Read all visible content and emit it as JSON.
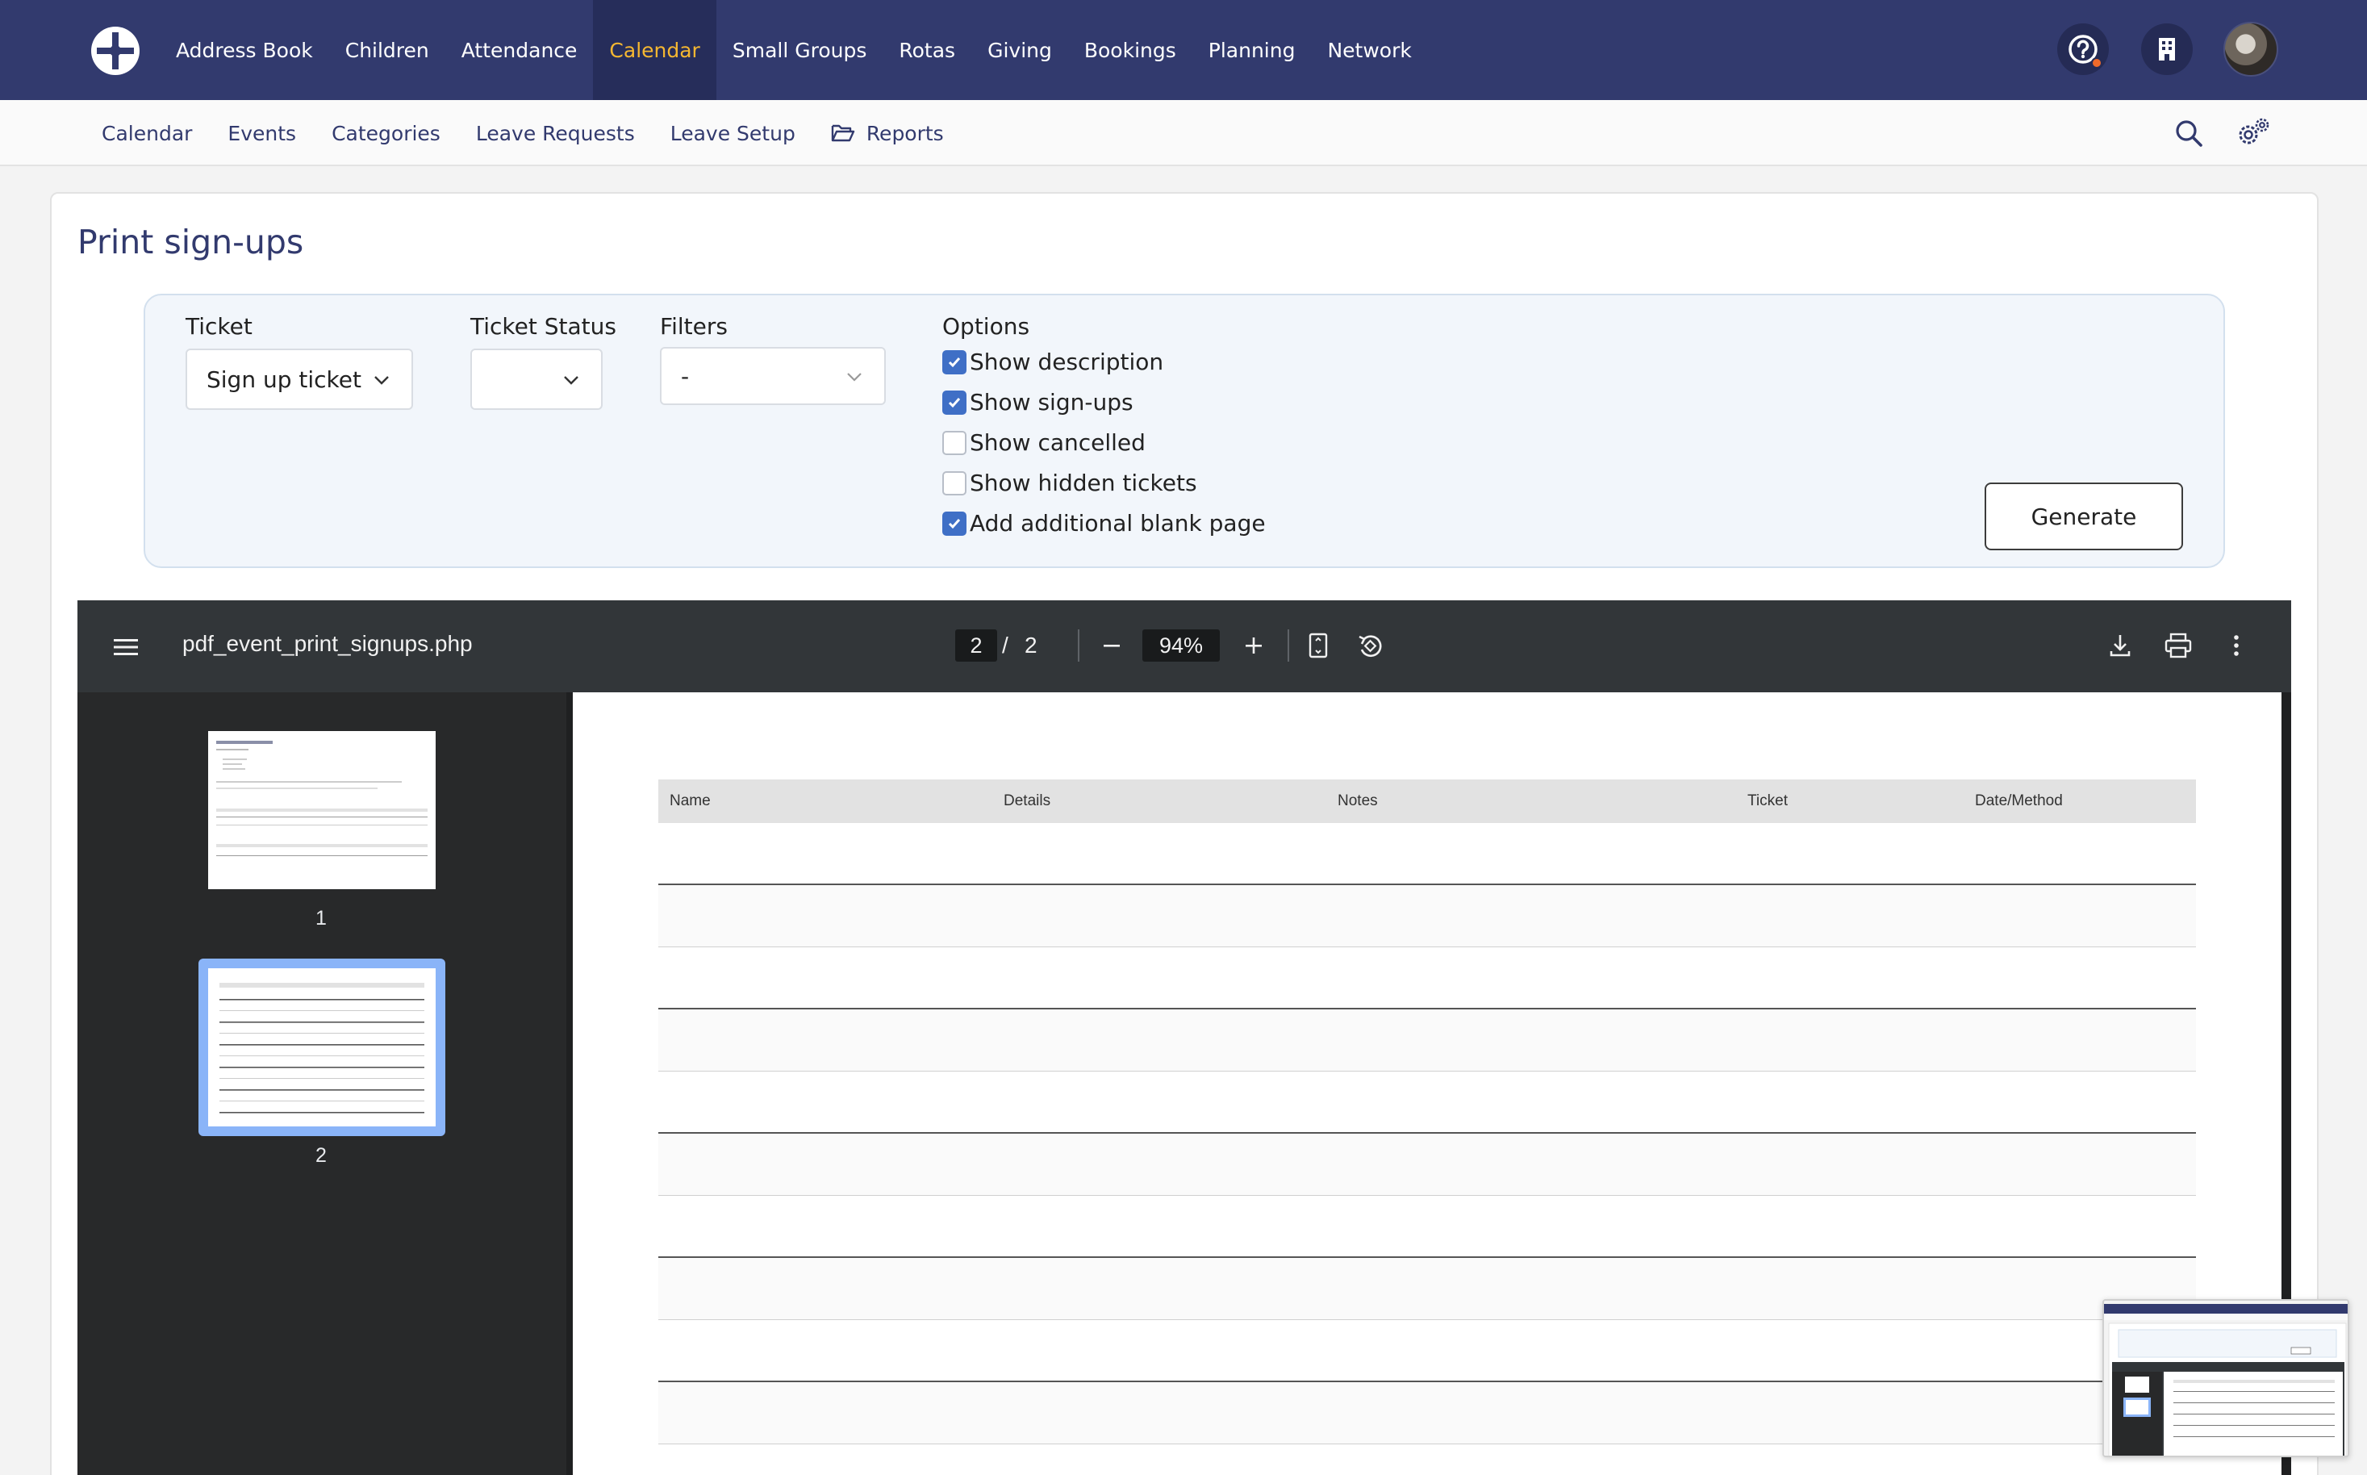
{
  "colors": {
    "nav_bg": "#323a6e",
    "nav_active": "#f5b731",
    "accent": "#3f6fc6",
    "viewer_bg": "#323639"
  },
  "topnav": {
    "items": [
      {
        "label": "Address Book"
      },
      {
        "label": "Children"
      },
      {
        "label": "Attendance"
      },
      {
        "label": "Calendar",
        "active": true
      },
      {
        "label": "Small Groups"
      },
      {
        "label": "Rotas"
      },
      {
        "label": "Giving"
      },
      {
        "label": "Bookings"
      },
      {
        "label": "Planning"
      },
      {
        "label": "Network"
      }
    ],
    "icons": [
      "logo-icon",
      "help-icon",
      "building-icon",
      "avatar"
    ]
  },
  "subnav": {
    "items": [
      {
        "label": "Calendar"
      },
      {
        "label": "Events"
      },
      {
        "label": "Categories"
      },
      {
        "label": "Leave Requests"
      },
      {
        "label": "Leave Setup"
      },
      {
        "label": "Reports",
        "icon": "folder-open-icon"
      }
    ],
    "icons": [
      "search-icon",
      "settings-gears-icon"
    ]
  },
  "page": {
    "title": "Print sign-ups"
  },
  "filters": {
    "ticket_label": "Ticket",
    "ticket_value": "Sign up ticket",
    "status_label": "Ticket Status",
    "status_value": "",
    "filters_label": "Filters",
    "filters_value": "-",
    "options_label": "Options",
    "options": [
      {
        "label": "Show description",
        "checked": true
      },
      {
        "label": "Show sign-ups",
        "checked": true
      },
      {
        "label": "Show cancelled",
        "checked": false
      },
      {
        "label": "Show hidden tickets",
        "checked": false
      },
      {
        "label": "Add additional blank page",
        "checked": true
      }
    ],
    "generate_label": "Generate"
  },
  "viewer": {
    "filename": "pdf_event_print_signups.php",
    "current_page": "2",
    "separator": "/",
    "total_pages": "2",
    "zoom": "94%",
    "thumbnails": [
      {
        "num": "1",
        "selected": false
      },
      {
        "num": "2",
        "selected": true
      }
    ],
    "table_headers": [
      "Name",
      "Details",
      "Notes",
      "Ticket",
      "Date/Method"
    ]
  }
}
